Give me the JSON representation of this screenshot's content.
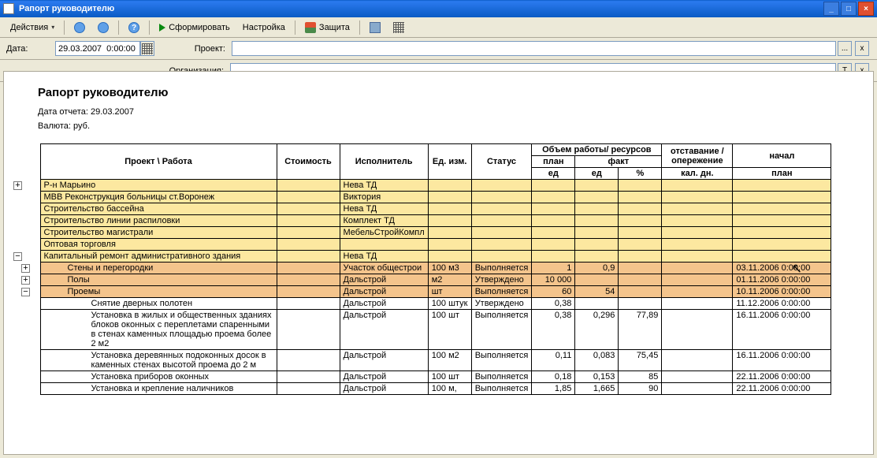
{
  "window": {
    "title": "Рапорт руководителю"
  },
  "toolbar": {
    "actions": "Действия",
    "generate": "Сформировать",
    "settings": "Настройка",
    "protect": "Защита"
  },
  "form": {
    "date_label": "Дата:",
    "date_value": "29.03.2007  0:00:00",
    "project_label": "Проект:",
    "project_value": "",
    "org_label": "Организация:",
    "org_value": "",
    "btn_ellipsis": "...",
    "btn_x": "x",
    "btn_t": "T"
  },
  "report": {
    "title": "Рапорт руководителю",
    "date_line": "Дата отчета: 29.03.2007",
    "currency_line": "Валюта: руб."
  },
  "headers": {
    "project": "Проект \\ Работа",
    "cost": "Стоимость",
    "executor": "Исполнитель",
    "unit": "Ед. изм.",
    "status": "Статус",
    "volume_group": "Объем работы/ ресурсов",
    "plan": "план",
    "fact": "факт",
    "ed": "ед",
    "pct": "%",
    "lag_group": "отставание /опережение",
    "cal_days": "кал. дн.",
    "start": "начал",
    "plan2": "план"
  },
  "rows": [
    {
      "cls": "lvl-yellow",
      "tree": "plus",
      "indent": 0,
      "name": "Р-н Марьино",
      "cost": "",
      "exec": "Нева ТД",
      "unit": "",
      "status": "",
      "plan": "",
      "fact": "",
      "pct": "",
      "cal": "",
      "start": ""
    },
    {
      "cls": "lvl-yellow",
      "tree": "",
      "indent": 0,
      "name": "МВВ Реконструкция больницы ст.Воронеж",
      "cost": "",
      "exec": "Виктория",
      "unit": "",
      "status": "",
      "plan": "",
      "fact": "",
      "pct": "",
      "cal": "",
      "start": ""
    },
    {
      "cls": "lvl-yellow",
      "tree": "",
      "indent": 0,
      "name": "Строительство бассейна",
      "cost": "",
      "exec": "Нева ТД",
      "unit": "",
      "status": "",
      "plan": "",
      "fact": "",
      "pct": "",
      "cal": "",
      "start": ""
    },
    {
      "cls": "lvl-yellow",
      "tree": "",
      "indent": 0,
      "name": "Строительство линии распиловки",
      "cost": "",
      "exec": "Комплект ТД",
      "unit": "",
      "status": "",
      "plan": "",
      "fact": "",
      "pct": "",
      "cal": "",
      "start": ""
    },
    {
      "cls": "lvl-yellow",
      "tree": "",
      "indent": 0,
      "name": "Строительство магистрали",
      "cost": "",
      "exec": "МебельСтройКомпл",
      "unit": "",
      "status": "",
      "plan": "",
      "fact": "",
      "pct": "",
      "cal": "",
      "start": ""
    },
    {
      "cls": "lvl-yellow",
      "tree": "",
      "indent": 0,
      "name": "Оптовая торговля",
      "cost": "",
      "exec": "",
      "unit": "",
      "status": "",
      "plan": "",
      "fact": "",
      "pct": "",
      "cal": "",
      "start": ""
    },
    {
      "cls": "lvl-yellow",
      "tree": "minus",
      "indent": 0,
      "name": "Капитальный ремонт административного здания",
      "cost": "",
      "exec": "Нева ТД",
      "unit": "",
      "status": "",
      "plan": "",
      "fact": "",
      "pct": "",
      "cal": "",
      "start": ""
    },
    {
      "cls": "lvl-orange",
      "tree": "plus",
      "indent": 1,
      "name": "Стены и перегородки",
      "cost": "",
      "exec": "Участок общестрои",
      "unit": "100 м3",
      "status": "Выполняется",
      "plan": "1",
      "fact": "0,9",
      "pct": "",
      "cal": "",
      "start": "03.11.2006 0:00:00"
    },
    {
      "cls": "lvl-orange",
      "tree": "plus",
      "indent": 1,
      "name": "Полы",
      "cost": "",
      "exec": "Дальстрой",
      "unit": "м2",
      "status": "Утверждено",
      "plan": "10 000",
      "fact": "",
      "pct": "",
      "cal": "",
      "start": "01.11.2006 0:00:00"
    },
    {
      "cls": "lvl-orange",
      "tree": "minus",
      "indent": 1,
      "name": "Проемы",
      "cost": "",
      "exec": "Дальстрой",
      "unit": "шт",
      "status": "Выполняется",
      "plan": "60",
      "fact": "54",
      "pct": "",
      "cal": "",
      "start": "10.11.2006 0:00:00"
    },
    {
      "cls": "lvl-white",
      "tree": "",
      "indent": 2,
      "name": "Снятие дверных полотен",
      "cost": "",
      "exec": "Дальстрой",
      "unit": "100 штук",
      "status": "Утверждено",
      "plan": "0,38",
      "fact": "",
      "pct": "",
      "cal": "",
      "start": "11.12.2006 0:00:00"
    },
    {
      "cls": "lvl-white",
      "tree": "",
      "indent": 2,
      "wrap": true,
      "name": "Установка в жилых и общественных зданиях блоков оконных с переплетами спаренными в стенах каменных площадью проема более 2 м2",
      "cost": "",
      "exec": "Дальстрой",
      "unit": "100 шт",
      "status": "Выполняется",
      "plan": "0,38",
      "fact": "0,296",
      "pct": "77,89",
      "cal": "",
      "start": "16.11.2006 0:00:00"
    },
    {
      "cls": "lvl-white",
      "tree": "",
      "indent": 2,
      "wrap": true,
      "name": "Установка деревянных подоконных досок в каменных стенах высотой проема до 2 м",
      "cost": "",
      "exec": "Дальстрой",
      "unit": "100 м2",
      "status": "Выполняется",
      "plan": "0,11",
      "fact": "0,083",
      "pct": "75,45",
      "cal": "",
      "start": "16.11.2006 0:00:00"
    },
    {
      "cls": "lvl-white",
      "tree": "",
      "indent": 2,
      "name": "Установка приборов оконных",
      "cost": "",
      "exec": "Дальстрой",
      "unit": "100 шт",
      "status": "Выполняется",
      "plan": "0,18",
      "fact": "0,153",
      "pct": "85",
      "cal": "",
      "start": "22.11.2006 0:00:00"
    },
    {
      "cls": "lvl-white",
      "tree": "",
      "indent": 2,
      "name": "Установка и крепление наличников",
      "cost": "",
      "exec": "Дальстрой",
      "unit": "100 м,",
      "status": "Выполняется",
      "plan": "1,85",
      "fact": "1,665",
      "pct": "90",
      "cal": "",
      "start": "22.11.2006 0:00:00"
    }
  ],
  "chart_data": {
    "type": "table",
    "title": "Рапорт руководителю",
    "columns": [
      "Проект \\ Работа",
      "Стоимость",
      "Исполнитель",
      "Ед. изм.",
      "Статус",
      "план ед",
      "факт ед",
      "факт %",
      "кал. дн.",
      "начал план"
    ],
    "rows": [
      [
        "Р-н Марьино",
        "",
        "Нева ТД",
        "",
        "",
        "",
        "",
        "",
        "",
        ""
      ],
      [
        "МВВ Реконструкция больницы ст.Воронеж",
        "",
        "Виктория",
        "",
        "",
        "",
        "",
        "",
        "",
        ""
      ],
      [
        "Строительство бассейна",
        "",
        "Нева ТД",
        "",
        "",
        "",
        "",
        "",
        "",
        ""
      ],
      [
        "Строительство линии распиловки",
        "",
        "Комплект ТД",
        "",
        "",
        "",
        "",
        "",
        "",
        ""
      ],
      [
        "Строительство магистрали",
        "",
        "МебельСтройКомпл",
        "",
        "",
        "",
        "",
        "",
        "",
        ""
      ],
      [
        "Оптовая торговля",
        "",
        "",
        "",
        "",
        "",
        "",
        "",
        "",
        ""
      ],
      [
        "Капитальный ремонт административного здания",
        "",
        "Нева ТД",
        "",
        "",
        "",
        "",
        "",
        "",
        ""
      ],
      [
        "Стены и перегородки",
        "",
        "Участок общестрои",
        "100 м3",
        "Выполняется",
        "1",
        "0,9",
        "",
        "",
        "03.11.2006 0:00:00"
      ],
      [
        "Полы",
        "",
        "Дальстрой",
        "м2",
        "Утверждено",
        "10 000",
        "",
        "",
        "",
        "01.11.2006 0:00:00"
      ],
      [
        "Проемы",
        "",
        "Дальстрой",
        "шт",
        "Выполняется",
        "60",
        "54",
        "",
        "",
        "10.11.2006 0:00:00"
      ],
      [
        "Снятие дверных полотен",
        "",
        "Дальстрой",
        "100 штук",
        "Утверждено",
        "0,38",
        "",
        "",
        "",
        "11.12.2006 0:00:00"
      ],
      [
        "Установка в жилых и общественных зданиях блоков оконных с переплетами спаренными в стенах каменных площадью проема более 2 м2",
        "",
        "Дальстрой",
        "100 шт",
        "Выполняется",
        "0,38",
        "0,296",
        "77,89",
        "",
        "16.11.2006 0:00:00"
      ],
      [
        "Установка деревянных подоконных досок в каменных стенах высотой проема до 2 м",
        "",
        "Дальстрой",
        "100 м2",
        "Выполняется",
        "0,11",
        "0,083",
        "75,45",
        "",
        "16.11.2006 0:00:00"
      ],
      [
        "Установка приборов оконных",
        "",
        "Дальстрой",
        "100 шт",
        "Выполняется",
        "0,18",
        "0,153",
        "85",
        "",
        "22.11.2006 0:00:00"
      ],
      [
        "Установка и крепление наличников",
        "",
        "Дальстрой",
        "100 м,",
        "Выполняется",
        "1,85",
        "1,665",
        "90",
        "",
        "22.11.2006 0:00:00"
      ]
    ]
  }
}
